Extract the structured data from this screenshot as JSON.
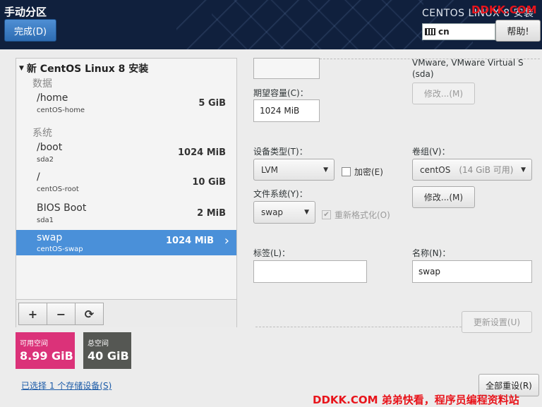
{
  "header": {
    "title": "手动分区",
    "done_label": "完成(D)",
    "product_title": "CENTOS LINUX 8 安装",
    "keyboard_layout": "cn",
    "help_label": "帮助!"
  },
  "partitions": {
    "install_title": "新 CentOS Linux 8 安装",
    "sections": [
      {
        "label": "数据",
        "items": [
          {
            "name": "/home",
            "device": "centOS-home",
            "size": "5 GiB"
          }
        ]
      },
      {
        "label": "系统",
        "items": [
          {
            "name": "/boot",
            "device": "sda2",
            "size": "1024 MiB"
          },
          {
            "name": "/",
            "device": "centOS-root",
            "size": "10 GiB"
          },
          {
            "name": "BIOS Boot",
            "device": "sda1",
            "size": "2 MiB"
          },
          {
            "name": "swap",
            "device": "centOS-swap",
            "size": "1024 MiB",
            "selected": true
          }
        ]
      }
    ],
    "toolbar": {
      "add": "+",
      "remove": "−",
      "refresh": "⟳"
    }
  },
  "space": {
    "available_label": "可用空间",
    "available_value": "8.99 GiB",
    "total_label": "总空间",
    "total_value": "40 GiB"
  },
  "storage_link": "已选择 1 个存储设备(S)",
  "reset_all_label": "全部重设(R)",
  "details": {
    "device_desc_line1": "VMware, VMware Virtual S",
    "device_desc_line2": "(sda)",
    "modify_top_label": "修改...(M)",
    "desired_capacity_label": "期望容量(C)：",
    "desired_capacity_value": "1024 MiB",
    "device_type_label": "设备类型(T)：",
    "device_type_value": "LVM",
    "encrypt_label": "加密(E)",
    "filesystem_label": "文件系统(Y)：",
    "filesystem_value": "swap",
    "reformat_label": "重新格式化(O)",
    "volume_group_label": "卷组(V)：",
    "volume_group_value": "centOS",
    "volume_group_free": "(14 GiB 可用)",
    "modify_vg_label": "修改...(M)",
    "label_label": "标签(L)：",
    "label_value": "",
    "name_label": "名称(N)：",
    "name_value": "swap",
    "update_label": "更新设置(U)"
  },
  "watermark": {
    "top": "DDKK.COM",
    "bottom": "DDKK.COM 弟弟快看，程序员编程资料站"
  },
  "colors": {
    "header_bg": "#10203d",
    "selected_row": "#4a90d9",
    "available_bg": "#db3279",
    "total_bg": "#555753",
    "watermark": "#e8141b"
  }
}
